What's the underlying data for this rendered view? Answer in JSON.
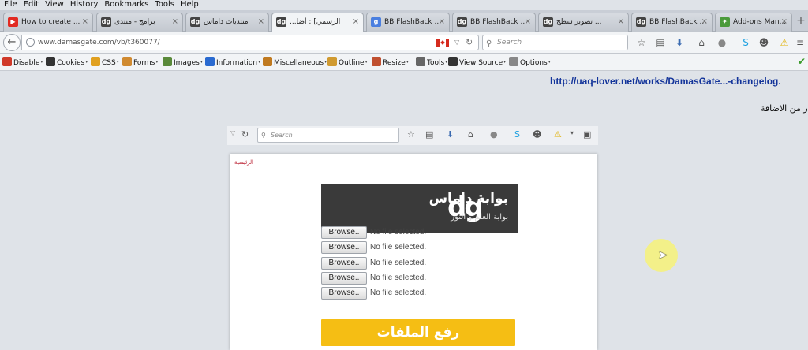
{
  "menu": [
    "File",
    "Edit",
    "View",
    "History",
    "Bookmarks",
    "Tools",
    "Help"
  ],
  "tabs": [
    {
      "label": "How to create ...",
      "icon": "youtube-icon",
      "color": "#e22a22",
      "glyph": "▶",
      "active": false
    },
    {
      "label": "برامج - منتدى",
      "icon": "dg-icon",
      "color": "#444444",
      "glyph": "dg",
      "active": false
    },
    {
      "label": "منتديات داماس",
      "icon": "dg-icon",
      "color": "#444444",
      "glyph": "dg",
      "active": false
    },
    {
      "label": "...الرسمي] : أضا",
      "icon": "dg-icon",
      "color": "#444444",
      "glyph": "dg",
      "active": true
    },
    {
      "label": "BB FlashBack ...",
      "icon": "google-icon",
      "color": "#4a7fe0",
      "glyph": "g",
      "active": false
    },
    {
      "label": "BB FlashBack ...",
      "icon": "dg-icon",
      "color": "#444444",
      "glyph": "dg",
      "active": false
    },
    {
      "label": "تصوير سطح ...",
      "icon": "dg-icon",
      "color": "#444444",
      "glyph": "dg",
      "active": false
    },
    {
      "label": "BB FlashBack ...",
      "icon": "dg-icon",
      "color": "#444444",
      "glyph": "dg",
      "active": false
    },
    {
      "label": "Add-ons Man...",
      "icon": "puzzle-icon",
      "color": "#4a9a3a",
      "glyph": "✦",
      "active": false
    }
  ],
  "navbar": {
    "url": "www.damasgate.com/vb/t360077/",
    "search_placeholder": "Search"
  },
  "toolbar": [
    {
      "label": "Disable",
      "icon": "disable-icon",
      "color": "#d03a2a"
    },
    {
      "label": "Cookies",
      "icon": "cookies-icon",
      "color": "#333333"
    },
    {
      "label": "CSS",
      "icon": "css-icon",
      "color": "#e0a020"
    },
    {
      "label": "Forms",
      "icon": "forms-icon",
      "color": "#d08a30"
    },
    {
      "label": "Images",
      "icon": "images-icon",
      "color": "#5a8a3a"
    },
    {
      "label": "Information",
      "icon": "information-icon",
      "color": "#2a6ad0"
    },
    {
      "label": "Miscellaneous",
      "icon": "miscellaneous-icon",
      "color": "#c07a20"
    },
    {
      "label": "Outline",
      "icon": "outline-icon",
      "color": "#d09a30"
    },
    {
      "label": "Resize",
      "icon": "resize-icon",
      "color": "#c05030"
    },
    {
      "label": "Tools",
      "icon": "tools-icon",
      "color": "#666666"
    },
    {
      "label": "View Source",
      "icon": "view-source-icon",
      "color": "#333333"
    },
    {
      "label": "Options",
      "icon": "options-icon",
      "color": "#888888"
    }
  ],
  "page": {
    "link": "http://uaq-lover.net/works/DamasGate...-changelog.",
    "arabic_text": "ر من الاضافة"
  },
  "inner": {
    "search_placeholder": "Search",
    "crumb": "الرئيسية",
    "banner_title": "بوابة داماس",
    "banner_sub": "بوابة العلم و النور",
    "banner_logo": "dg",
    "browse_label": "Browse..",
    "no_file": "No file selected.",
    "upload_label": "رفع الملفات"
  },
  "colors": {
    "link": "#13349a",
    "upload": "#f5be14",
    "banner": "#3a3a3a",
    "halo": "#f7f278"
  }
}
